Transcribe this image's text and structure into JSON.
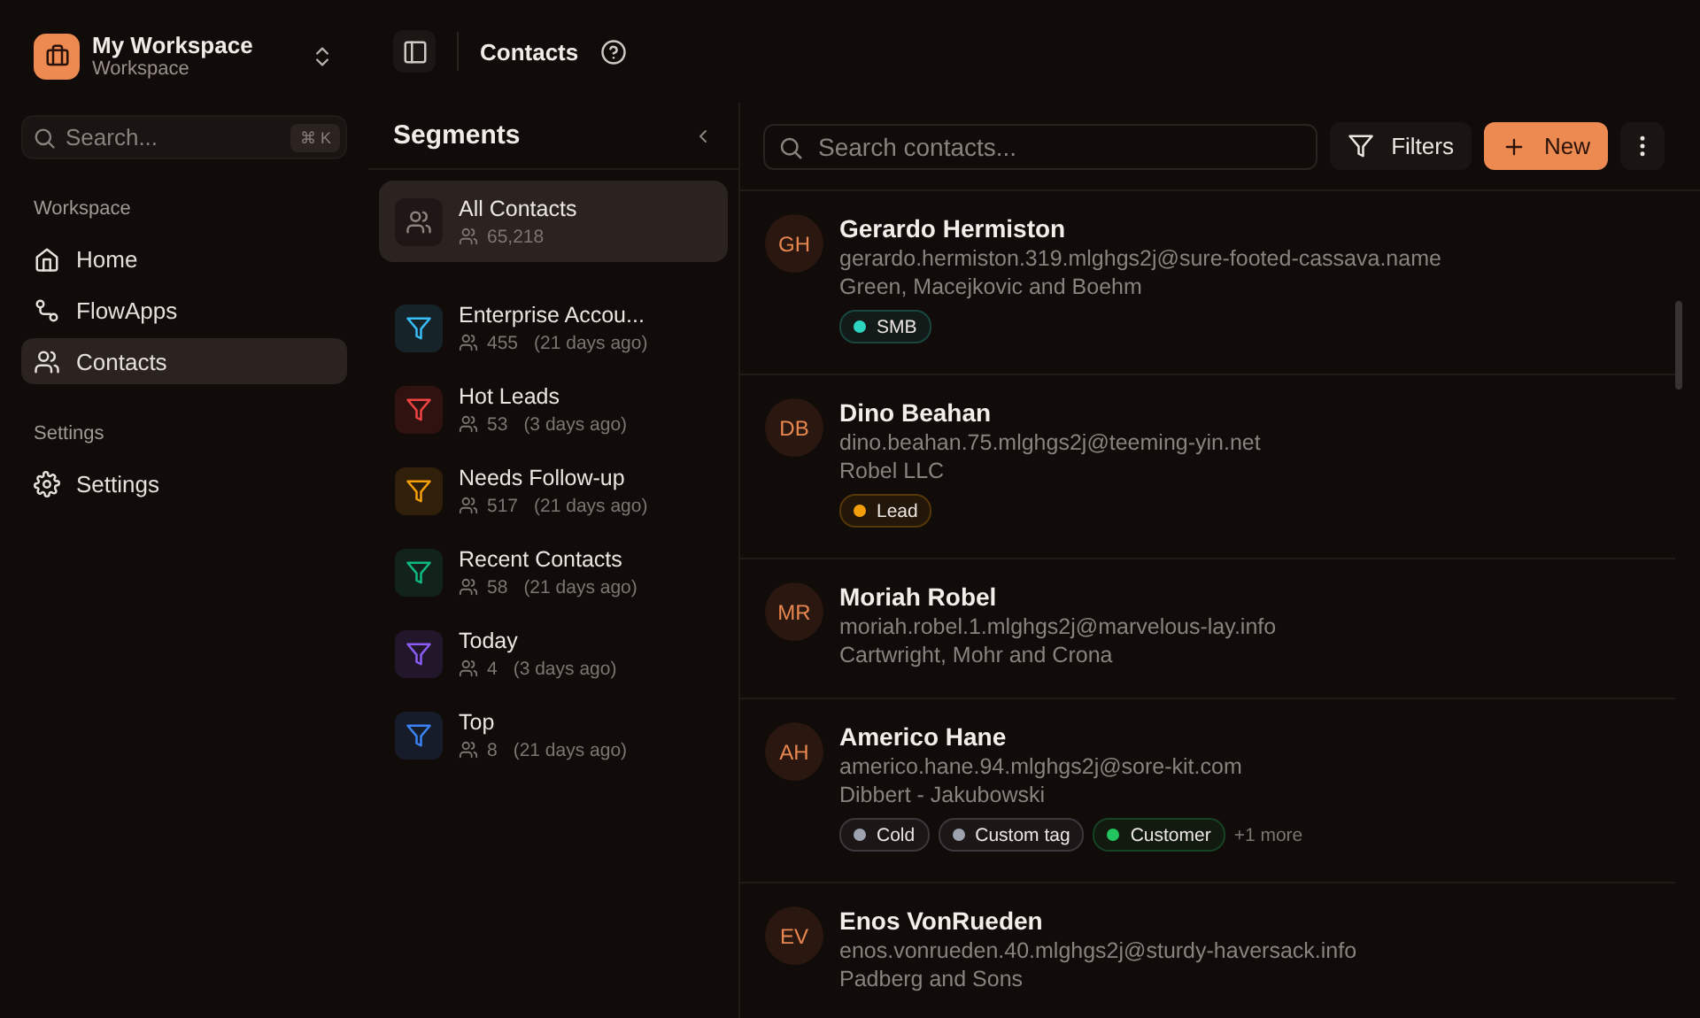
{
  "workspace": {
    "name": "My Workspace",
    "subtitle": "Workspace"
  },
  "search": {
    "placeholder": "Search...",
    "shortcut": "⌘ K"
  },
  "sidebar": {
    "sections": [
      {
        "title": "Workspace",
        "items": [
          {
            "label": "Home",
            "selected": false
          },
          {
            "label": "FlowApps",
            "selected": false
          },
          {
            "label": "Contacts",
            "selected": true
          }
        ]
      },
      {
        "title": "Settings",
        "items": [
          {
            "label": "Settings",
            "selected": false
          }
        ]
      }
    ]
  },
  "header": {
    "title": "Contacts"
  },
  "segments": {
    "title": "Segments",
    "items": [
      {
        "kind": "all",
        "name": "All Contacts",
        "count": "65,218",
        "selected": true
      },
      {
        "kind": "filter",
        "name": "Enterprise Accou...",
        "count": "455",
        "updated": "(21 days ago)",
        "color": "#38bdf8",
        "selected": false
      },
      {
        "kind": "filter",
        "name": "Hot Leads",
        "count": "53",
        "updated": "(3 days ago)",
        "color": "#ef4444",
        "selected": false
      },
      {
        "kind": "filter",
        "name": "Needs Follow-up",
        "count": "517",
        "updated": "(21 days ago)",
        "color": "#f59e0b",
        "selected": false
      },
      {
        "kind": "filter",
        "name": "Recent Contacts",
        "count": "58",
        "updated": "(21 days ago)",
        "color": "#10b981",
        "selected": false
      },
      {
        "kind": "filter",
        "name": "Today",
        "count": "4",
        "updated": "(3 days ago)",
        "color": "#8b5cf6",
        "selected": false
      },
      {
        "kind": "filter",
        "name": "Top",
        "count": "8",
        "updated": "(21 days ago)",
        "color": "#3b82f6",
        "selected": false
      }
    ]
  },
  "toolbar": {
    "search_placeholder": "Search contacts...",
    "filters": "Filters",
    "new": "New"
  },
  "contacts": [
    {
      "initials": "GH",
      "name": "Gerardo Hermiston",
      "email": "gerardo.hermiston.319.mlghgs2j@sure-footed-cassava.name",
      "company": "Green, Macejkovic and Boehm",
      "tags": [
        {
          "label": "SMB",
          "color": "#2dd4bf"
        }
      ]
    },
    {
      "initials": "DB",
      "name": "Dino Beahan",
      "email": "dino.beahan.75.mlghgs2j@teeming-yin.net",
      "company": "Robel LLC",
      "tags": [
        {
          "label": "Lead",
          "color": "#f59e0b"
        }
      ]
    },
    {
      "initials": "MR",
      "name": "Moriah Robel",
      "email": "moriah.robel.1.mlghgs2j@marvelous-lay.info",
      "company": "Cartwright, Mohr and Crona"
    },
    {
      "initials": "AH",
      "name": "Americo Hane",
      "email": "americo.hane.94.mlghgs2j@sore-kit.com",
      "company": "Dibbert - Jakubowski",
      "tags": [
        {
          "label": "Cold",
          "color": "#9ca3af"
        },
        {
          "label": "Custom tag",
          "color": "#9ca3af"
        },
        {
          "label": "Customer",
          "color": "#22c55e"
        }
      ],
      "more": "+1 more"
    },
    {
      "initials": "EV",
      "name": "Enos VonRueden",
      "email": "enos.vonrueden.40.mlghgs2j@sturdy-haversack.info",
      "company": "Padberg and Sons"
    }
  ]
}
